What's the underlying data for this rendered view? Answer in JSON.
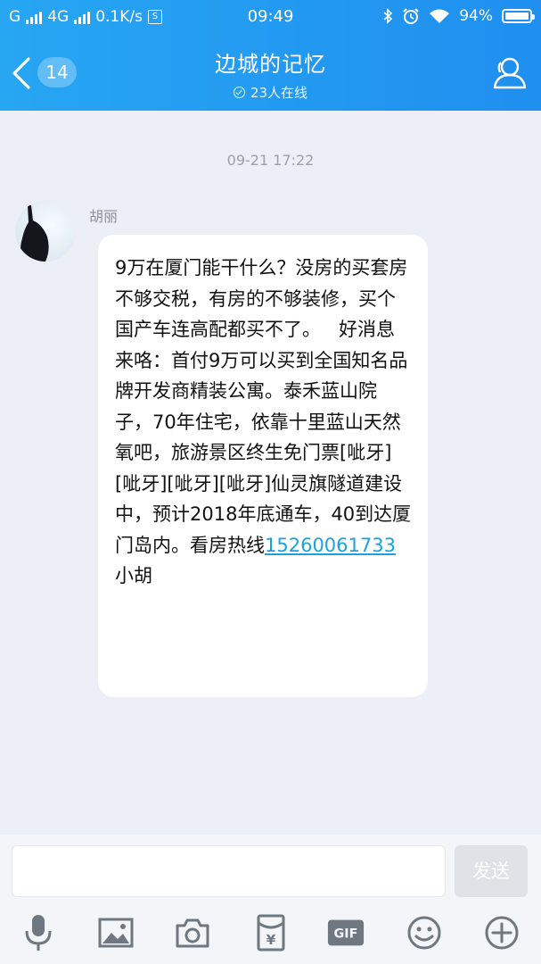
{
  "status_bar": {
    "carrier1": "G",
    "network": "4G",
    "speed": "0.1K/s",
    "s_icon": "S",
    "time": "09:49",
    "battery": "94%",
    "battery_level": 0.94
  },
  "header": {
    "back_badge": "14",
    "title": "边城的记忆",
    "online": "23人在线"
  },
  "chat": {
    "timestamp": "09-21 17:22",
    "message": {
      "sender": "胡丽",
      "text_before": "9万在厦门能干什么？没房的买套房不够交税，有房的不够装修，买个国产车连高配都买不了。   好消息来咯：首付9万可以买到全国知名品牌开发商精装公寓。泰禾蓝山院子，70年住宅，依靠十里蓝山天然氧吧，旅游景区终生免门票[呲牙][呲牙][呲牙][呲牙]仙灵旗隧道建设中，预计2018年底通车，40到达厦门岛内。看房热线",
      "phone": "15260061733",
      "text_after": " 小胡"
    }
  },
  "input": {
    "placeholder": "",
    "send_label": "发送"
  },
  "toolbar": {
    "icons": [
      "microphone-icon",
      "image-icon",
      "camera-icon",
      "red-packet-icon",
      "gif-icon",
      "emoji-icon",
      "plus-icon"
    ],
    "gif_label": "GIF",
    "red_packet_label": "¥"
  },
  "colors": {
    "header_start": "#27a6f2",
    "header_end": "#1f8ff0",
    "background": "#eceff5",
    "link": "#1aa2e0"
  }
}
